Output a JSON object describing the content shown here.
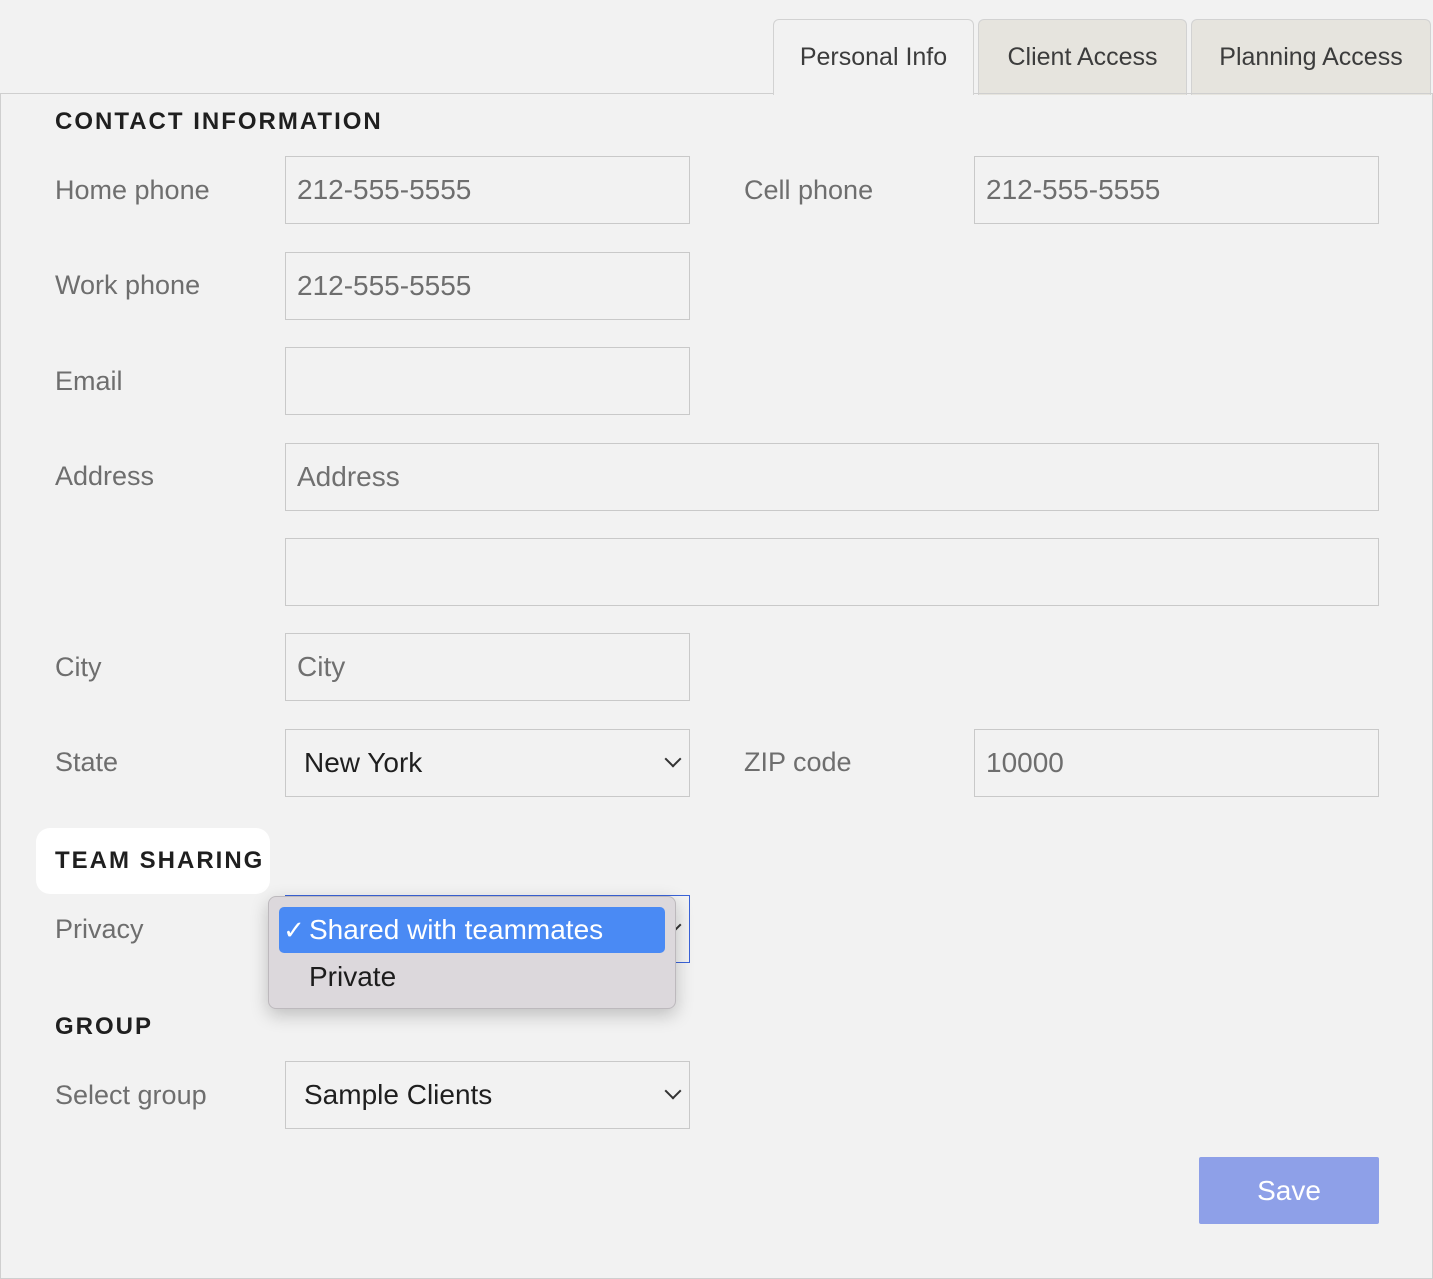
{
  "tabs": [
    {
      "label": "Personal Info",
      "active": true
    },
    {
      "label": "Client Access",
      "active": false
    },
    {
      "label": "Planning Access",
      "active": false
    }
  ],
  "contact": {
    "title": "CONTACT INFORMATION",
    "home_phone": {
      "label": "Home phone",
      "value": "212-555-5555"
    },
    "cell_phone": {
      "label": "Cell phone",
      "value": "212-555-5555"
    },
    "work_phone": {
      "label": "Work phone",
      "value": "212-555-5555"
    },
    "email": {
      "label": "Email",
      "value": ""
    },
    "address": {
      "label": "Address",
      "placeholder": "Address",
      "line2": ""
    },
    "city": {
      "label": "City",
      "placeholder": "City"
    },
    "state": {
      "label": "State",
      "value": "New York"
    },
    "zip": {
      "label": "ZIP code",
      "value": "10000"
    }
  },
  "team_sharing": {
    "title": "TEAM SHARING",
    "privacy_label": "Privacy",
    "options": [
      {
        "label": "Shared with teammates",
        "selected": true
      },
      {
        "label": "Private",
        "selected": false
      }
    ],
    "check_mark": "✓"
  },
  "group": {
    "title": "GROUP",
    "select_label": "Select group",
    "value": "Sample Clients"
  },
  "actions": {
    "save_label": "Save"
  },
  "colors": {
    "accent_selected": "#4a8af4",
    "save_button": "#8ea0e8",
    "background": "#f2f2f2"
  }
}
